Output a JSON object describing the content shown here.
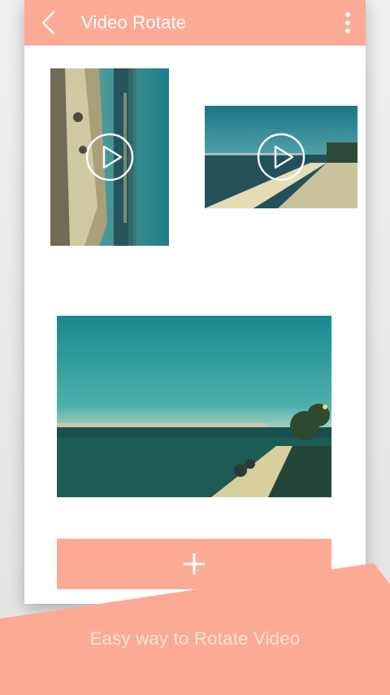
{
  "app": {
    "title": "Video Rotate"
  },
  "icons": {
    "back": "chevron-left-icon",
    "menu": "more-vert-icon",
    "play": "play-circle-icon",
    "add": "plus-icon"
  },
  "colors": {
    "accent": "#fbab95",
    "background": "#e9e9e9",
    "card": "#ffffff"
  },
  "footer": {
    "tagline": "Easy way to Rotate Video"
  }
}
